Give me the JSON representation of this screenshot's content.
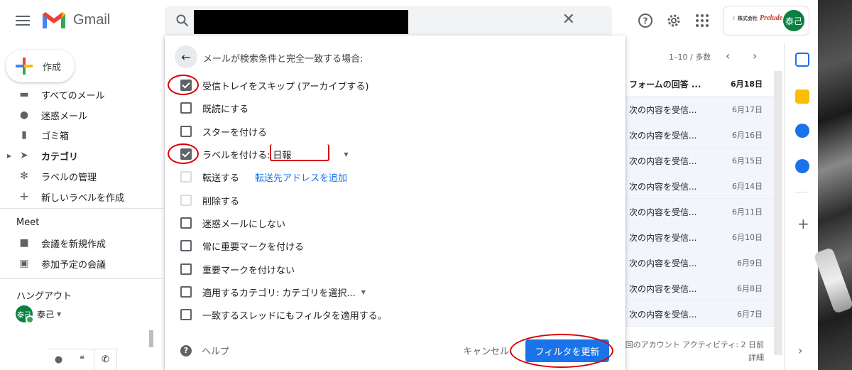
{
  "app": {
    "name": "Gmail"
  },
  "compose": {
    "label": "作成"
  },
  "sidebar": {
    "items": [
      {
        "label": "すべてのメール",
        "icon": "all-mail-icon"
      },
      {
        "label": "迷惑メール",
        "icon": "spam-icon"
      },
      {
        "label": "ゴミ箱",
        "icon": "trash-icon"
      },
      {
        "label": "カテゴリ",
        "icon": "label-icon"
      },
      {
        "label": "ラベルの管理",
        "icon": "gear-icon"
      },
      {
        "label": "新しいラベルを作成",
        "icon": "plus-icon"
      }
    ],
    "meet": {
      "title": "Meet",
      "items": [
        {
          "label": "会議を新規作成",
          "icon": "video-icon"
        },
        {
          "label": "参加予定の会議",
          "icon": "calendar-icon"
        }
      ]
    },
    "hangouts": {
      "title": "ハングアウト",
      "user": "泰己",
      "avatar": "泰己"
    }
  },
  "account": {
    "avatar": "泰己",
    "company_prefix": "株式会社",
    "company_name": "Prelude"
  },
  "list": {
    "page_info": "1–10 / 多数",
    "rows": [
      {
        "subject": "フォームの回答 ...",
        "date": "6月18日",
        "unread": true
      },
      {
        "subject": "次の内容を受信...",
        "date": "6月17日",
        "unread": false
      },
      {
        "subject": "次の内容を受信...",
        "date": "6月16日",
        "unread": false
      },
      {
        "subject": "次の内容を受信...",
        "date": "6月15日",
        "unread": false
      },
      {
        "subject": "次の内容を受信...",
        "date": "6月14日",
        "unread": false
      },
      {
        "subject": "次の内容を受信...",
        "date": "6月11日",
        "unread": false
      },
      {
        "subject": "次の内容を受信...",
        "date": "6月10日",
        "unread": false
      },
      {
        "subject": "次の内容を受信...",
        "date": "6月9日",
        "unread": false
      },
      {
        "subject": "次の内容を受信...",
        "date": "6月8日",
        "unread": false
      },
      {
        "subject": "次の内容を受信...",
        "date": "6月7日",
        "unread": false
      }
    ],
    "activity_line1": "回のアカウント アクティビティ: 2 日前",
    "activity_line2": "詳細"
  },
  "filter": {
    "title": "メールが検索条件と完全一致する場合:",
    "options": {
      "skip_inbox": {
        "label": "受信トレイをスキップ (アーカイブする)",
        "checked": true
      },
      "mark_read": {
        "label": "既読にする",
        "checked": false
      },
      "star": {
        "label": "スターを付ける",
        "checked": false
      },
      "apply_label": {
        "label": "ラベルを付ける:",
        "checked": true,
        "value": "日報"
      },
      "forward": {
        "label": "転送する",
        "checked": false,
        "link": "転送先アドレスを追加"
      },
      "delete": {
        "label": "削除する",
        "checked": false
      },
      "never_spam": {
        "label": "迷惑メールにしない",
        "checked": false
      },
      "always_important": {
        "label": "常に重要マークを付ける",
        "checked": false
      },
      "never_important": {
        "label": "重要マークを付けない",
        "checked": false
      },
      "category": {
        "label": "適用するカテゴリ:",
        "checked": false,
        "value": "カテゴリを選択..."
      },
      "apply_matching": {
        "label": "一致するスレッドにもフィルタを適用する。",
        "checked": false
      }
    },
    "help": "ヘルプ",
    "cancel": "キャンセル",
    "update": "フィルタを更新"
  },
  "colors": {
    "primary": "#1a73e8",
    "annotation": "#d50000",
    "avatar": "#0b8043"
  }
}
